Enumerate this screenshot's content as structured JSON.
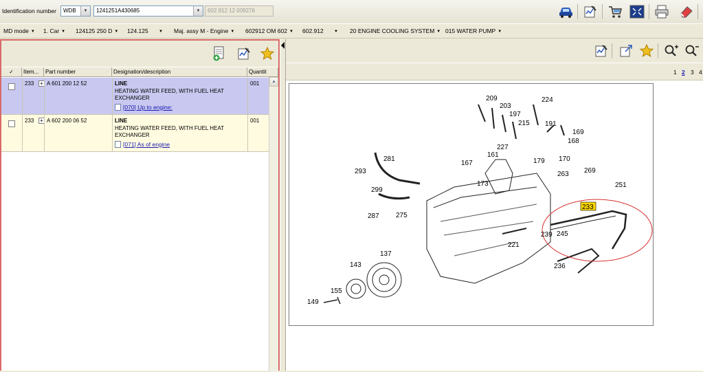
{
  "topbar": {
    "id_label": "Identification number",
    "wdb_value": "WDB",
    "vin_value": "1241251A430685",
    "engine_value": "602.912 12 009276",
    "icons": [
      "car-search-icon",
      "edit-note-icon",
      "cart-icon",
      "fit-view-icon",
      "print-icon",
      "eraser-icon"
    ]
  },
  "nav": {
    "items": [
      "MD mode",
      "1. Car",
      "124125 250 D",
      "124.125",
      "",
      "Maj. assy M - Engine",
      "602912 OM 602",
      "602.912",
      "",
      "20 ENGINE COOLING SYSTEM",
      "015 WATER PUMP"
    ]
  },
  "left": {
    "toolbar_icons": [
      "add-to-list-icon",
      "edit-note-icon",
      "favorite-star-icon"
    ],
    "columns": {
      "check": "✓",
      "item": "Item...",
      "part": "Part number",
      "desc": "Designation/description",
      "qty": "Quantit"
    },
    "rows": [
      {
        "item": "233",
        "part": "A 601 200 12 52",
        "title": "LINE",
        "desc": "HEATING WATER FEED, WITH FUEL HEAT EXCHANGER",
        "qty": "001",
        "link": "[070] Up to engine:",
        "selected": true
      },
      {
        "item": "233",
        "part": "A 602 200 06 52",
        "title": "LINE",
        "desc": "HEATING WATER FEED, WITH FUEL HEAT EXCHANGER",
        "qty": "001",
        "link": "[071] As of engine",
        "selected": false
      }
    ]
  },
  "right": {
    "toolbar_icons": [
      "edit-note-icon",
      "resize-icon",
      "favorite-star-icon",
      "zoom-in-icon",
      "zoom-out-icon"
    ],
    "pages": [
      "1",
      "2",
      "3",
      "4"
    ],
    "current_page": "2",
    "highlight_label": "233",
    "callouts": [
      "209",
      "224",
      "203",
      "197",
      "215",
      "191",
      "169",
      "168",
      "170",
      "227",
      "179",
      "161",
      "167",
      "281",
      "293",
      "299",
      "173",
      "263",
      "269",
      "251",
      "287",
      "275",
      "239",
      "245",
      "221",
      "236",
      "137",
      "143",
      "155",
      "149"
    ]
  },
  "colors": {
    "selected_row": "#c8c8f0",
    "alt_row": "#fffbe0",
    "pane_border": "#d86a6a",
    "highlight": "#ffd800",
    "ellipse": "#d83030",
    "link": "#1a1ab0"
  }
}
